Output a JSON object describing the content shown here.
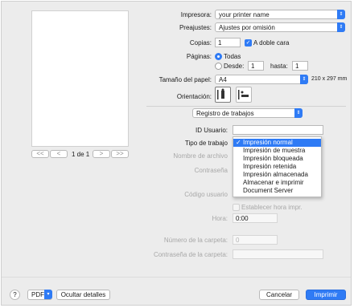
{
  "printer": {
    "label": "Impresora:",
    "value": "your printer name"
  },
  "presets": {
    "label": "Preajustes:",
    "value": "Ajustes por omisión"
  },
  "copies": {
    "label": "Copias:",
    "value": "1",
    "duplex_label": "A doble cara",
    "duplex_checked": true
  },
  "pages": {
    "label": "Páginas:",
    "all_label": "Todas",
    "from_label": "Desde:",
    "from_value": "1",
    "to_label": "hasta:",
    "to_value": "1"
  },
  "paper": {
    "label": "Tamaño del papel:",
    "value": "A4",
    "dimensions": "210 x 297 mm"
  },
  "orientation": {
    "label": "Orientación:"
  },
  "section": {
    "value": "Registro de trabajos"
  },
  "preview": {
    "page_indicator": "1 de 1",
    "first_label": "<<",
    "prev_label": "<",
    "next_label": ">",
    "last_label": ">>"
  },
  "job_log": {
    "user_id_label": "ID Usuario:",
    "job_type_label": "Tipo de trabajo",
    "file_name_label": "Nombre de archivo",
    "password_label": "Contraseña",
    "user_code_label": "Código usuario",
    "set_time_label": "Establecer hora impr.",
    "time_label": "Hora:",
    "time_value": "0:00",
    "folder_number_label": "Número de la carpeta:",
    "folder_number_value": "0",
    "folder_password_label": "Contraseña de la carpeta:"
  },
  "job_type_menu": {
    "items": [
      "Impresión normal",
      "Impresión de muestra",
      "Impresión bloqueada",
      "Impresión retenida",
      "Impresión almacenada",
      "Almacenar e imprimir",
      "Document Server"
    ],
    "selected_index": 0
  },
  "footer": {
    "help_label": "?",
    "pdf_label": "PDF",
    "hide_details_label": "Ocultar detalles",
    "cancel_label": "Cancelar",
    "print_label": "Imprimir"
  },
  "colors": {
    "accent": "#2f7bf5",
    "window_bg": "#ececec"
  }
}
